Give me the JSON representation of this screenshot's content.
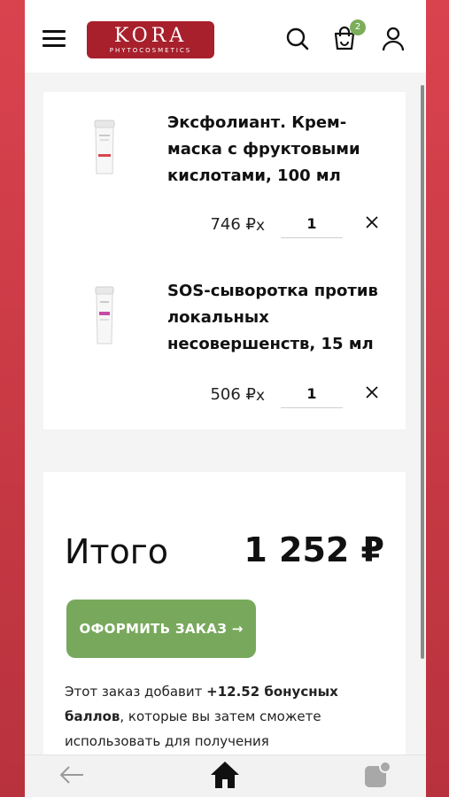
{
  "header": {
    "logo_brand": "KORA",
    "logo_sub": "PHYTOCOSMETICS",
    "cart_count": "2",
    "icons": [
      "menu-icon",
      "search-icon",
      "cart-icon",
      "user-icon"
    ]
  },
  "cart": {
    "items": [
      {
        "name": "Эксфолиант. Крем-маска с фруктовыми кислотами, 100 мл",
        "price": "746 ₽",
        "times": "x",
        "quantity": "1"
      },
      {
        "name": "SOS-сыворотка против локальных несовершенств, 15 мл",
        "price": "506 ₽",
        "times": "x",
        "quantity": "1"
      }
    ]
  },
  "summary": {
    "total_label": "Итого",
    "total_value": "1 252 ₽",
    "checkout_label": "ОФОРМИТЬ ЗАКАЗ →",
    "bonus_prefix": "Этот заказ добавит ",
    "bonus_amount": "+12.52 бонусных баллов",
    "bonus_suffix": ", которые вы затем сможете использовать для получения"
  },
  "colors": {
    "brand": "#a7202c",
    "accent_green": "#78a85c",
    "page_frame": "#c93a45"
  },
  "bottom_nav": {
    "icons": [
      "back-arrow-icon",
      "home-icon",
      "notification-icon"
    ]
  }
}
